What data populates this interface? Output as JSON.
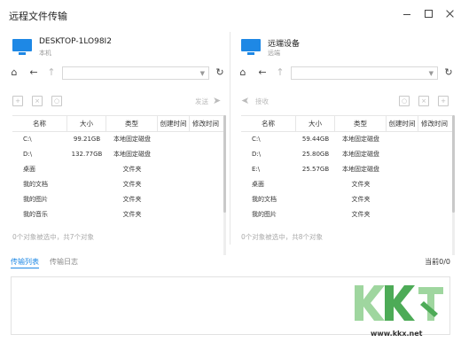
{
  "window": {
    "title": "远程文件传输"
  },
  "local": {
    "device_name": "DESKTOP-1LO98I2",
    "device_sub": "本机",
    "action_label": "发送",
    "columns": [
      "名称",
      "大小",
      "类型",
      "创建时间",
      "修改时间"
    ],
    "rows": [
      {
        "name": "C:\\",
        "size": "99.21GB",
        "type": "本地固定磁盘",
        "ctime": "",
        "mtime": ""
      },
      {
        "name": "D:\\",
        "size": "132.77GB",
        "type": "本地固定磁盘",
        "ctime": "",
        "mtime": ""
      },
      {
        "name": "桌面",
        "size": "",
        "type": "文件夹",
        "ctime": "",
        "mtime": ""
      },
      {
        "name": "我的文档",
        "size": "",
        "type": "文件夹",
        "ctime": "",
        "mtime": ""
      },
      {
        "name": "我的图片",
        "size": "",
        "type": "文件夹",
        "ctime": "",
        "mtime": ""
      },
      {
        "name": "我的音乐",
        "size": "",
        "type": "文件夹",
        "ctime": "",
        "mtime": ""
      }
    ],
    "status": "0个对象被选中，共7个对象"
  },
  "remote": {
    "device_name": "远端设备",
    "device_sub": "远端",
    "action_label": "接收",
    "columns": [
      "名称",
      "大小",
      "类型",
      "创建时间",
      "修改时间"
    ],
    "rows": [
      {
        "name": "C:\\",
        "size": "59.44GB",
        "type": "本地固定磁盘",
        "ctime": "",
        "mtime": ""
      },
      {
        "name": "D:\\",
        "size": "25.80GB",
        "type": "本地固定磁盘",
        "ctime": "",
        "mtime": ""
      },
      {
        "name": "E:\\",
        "size": "25.57GB",
        "type": "本地固定磁盘",
        "ctime": "",
        "mtime": ""
      },
      {
        "name": "桌面",
        "size": "",
        "type": "文件夹",
        "ctime": "",
        "mtime": ""
      },
      {
        "name": "我的文档",
        "size": "",
        "type": "文件夹",
        "ctime": "",
        "mtime": ""
      },
      {
        "name": "我的图片",
        "size": "",
        "type": "文件夹",
        "ctime": "",
        "mtime": ""
      }
    ],
    "status": "0个对象被选中，共8个对象"
  },
  "bottom": {
    "tab_transfer_list": "传输列表",
    "tab_transfer_log": "传输日志",
    "queue_count": "当前0/0"
  },
  "watermark": {
    "url": "www.kkx.net"
  },
  "colors": {
    "accent": "#1e88e5",
    "watermark_green": "#2e9d3a",
    "watermark_light": "#8fd08f"
  },
  "icons": {
    "home": "home-icon",
    "back": "arrow-left-icon",
    "up": "arrow-up-icon",
    "refresh": "refresh-icon",
    "new_folder": "new-folder-icon",
    "delete": "trash-icon",
    "search": "search-folder-icon"
  }
}
